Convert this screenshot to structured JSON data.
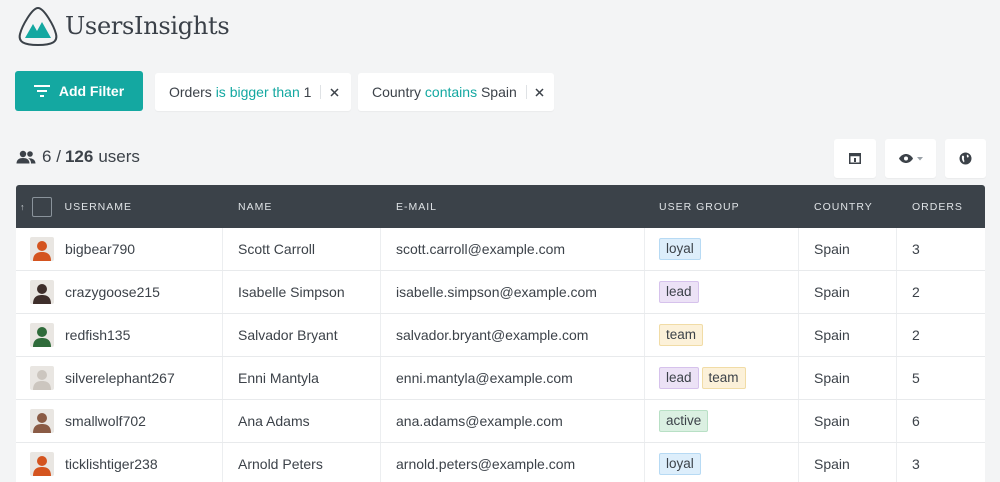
{
  "app": {
    "name": "UsersInsights"
  },
  "colors": {
    "accent": "#14a8a1",
    "header_bg": "#3b4249",
    "page_bg": "#f3f4f5"
  },
  "toolbar": {
    "add_filter_label": "Add Filter"
  },
  "filters": [
    {
      "field": "Orders",
      "operator": "is bigger than",
      "value": "1"
    },
    {
      "field": "Country",
      "operator": "contains",
      "value": "Spain"
    }
  ],
  "summary": {
    "shown": "6",
    "separator": "/",
    "total": "126",
    "unit": "users"
  },
  "icons": {
    "users": "users-icon",
    "filter": "filter-icon",
    "close": "close-icon",
    "columns": "columns-icon",
    "visibility": "eye-icon",
    "map": "globe-icon"
  },
  "table": {
    "sort_indicator": "↑",
    "columns": [
      "USERNAME",
      "NAME",
      "E-MAIL",
      "USER GROUP",
      "COUNTRY",
      "ORDERS"
    ],
    "rows": [
      {
        "username": "bigbear790",
        "name": "Scott Carroll",
        "email": "scott.carroll@example.com",
        "groups": [
          "loyal"
        ],
        "country": "Spain",
        "orders": "3"
      },
      {
        "username": "crazygoose215",
        "name": "Isabelle Simpson",
        "email": "isabelle.simpson@example.com",
        "groups": [
          "lead"
        ],
        "country": "Spain",
        "orders": "2"
      },
      {
        "username": "redfish135",
        "name": "Salvador Bryant",
        "email": "salvador.bryant@example.com",
        "groups": [
          "team"
        ],
        "country": "Spain",
        "orders": "2"
      },
      {
        "username": "silverelephant267",
        "name": "Enni Mantyla",
        "email": "enni.mantyla@example.com",
        "groups": [
          "lead",
          "team"
        ],
        "country": "Spain",
        "orders": "5"
      },
      {
        "username": "smallwolf702",
        "name": "Ana Adams",
        "email": "ana.adams@example.com",
        "groups": [
          "active"
        ],
        "country": "Spain",
        "orders": "6"
      },
      {
        "username": "ticklishtiger238",
        "name": "Arnold Peters",
        "email": "arnold.peters@example.com",
        "groups": [
          "loyal"
        ],
        "country": "Spain",
        "orders": "3"
      }
    ]
  },
  "group_colors": {
    "loyal": {
      "bg": "#ddeefb",
      "border": "#b7daf4"
    },
    "lead": {
      "bg": "#ece2f6",
      "border": "#d6c2ec"
    },
    "team": {
      "bg": "#fcf1d9",
      "border": "#f1dca6"
    },
    "active": {
      "bg": "#dbf0e2",
      "border": "#b8e0c5"
    }
  },
  "avatar_colors": [
    "#d4541f",
    "#3e2e2b",
    "#2f6b3a",
    "#ccc6bf",
    "#8a5b45",
    "#d4541f"
  ]
}
